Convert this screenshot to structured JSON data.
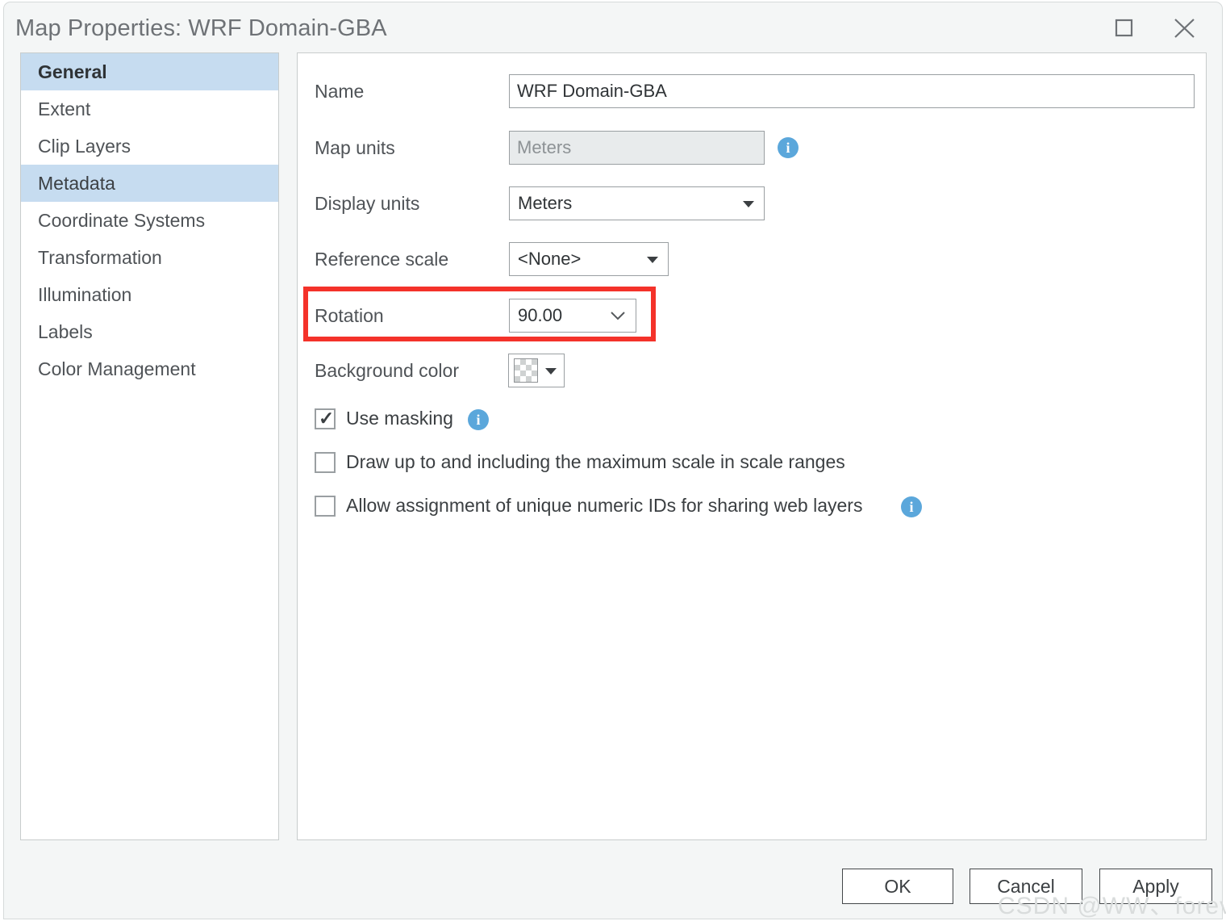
{
  "window": {
    "title": "Map Properties: WRF Domain-GBA",
    "maximize_icon": "maximize-icon",
    "close_icon": "close-icon"
  },
  "sidebar": {
    "items": [
      {
        "label": "General",
        "state": "selected"
      },
      {
        "label": "Extent",
        "state": "normal"
      },
      {
        "label": "Clip Layers",
        "state": "normal"
      },
      {
        "label": "Metadata",
        "state": "hover"
      },
      {
        "label": "Coordinate Systems",
        "state": "normal"
      },
      {
        "label": "Transformation",
        "state": "normal"
      },
      {
        "label": "Illumination",
        "state": "normal"
      },
      {
        "label": "Labels",
        "state": "normal"
      },
      {
        "label": "Color Management",
        "state": "normal"
      }
    ]
  },
  "general": {
    "name": {
      "label": "Name",
      "value": "WRF Domain-GBA"
    },
    "map_units": {
      "label": "Map units",
      "value": "Meters",
      "readonly": true,
      "info_icon": "info-icon"
    },
    "display_units": {
      "label": "Display units",
      "value": "Meters",
      "dropdown_icon": "chevron-down-icon"
    },
    "reference_scale": {
      "label": "Reference scale",
      "value": "<None>",
      "dropdown_icon": "chevron-down-icon"
    },
    "rotation": {
      "label": "Rotation",
      "value": "90.00",
      "dropdown_icon": "chevron-down-icon"
    },
    "background_color": {
      "label": "Background color",
      "value": "transparent",
      "dropdown_icon": "chevron-down-icon"
    },
    "checkboxes": [
      {
        "label": "Use masking",
        "checked": true,
        "has_info": true
      },
      {
        "label": "Draw up to and including the maximum scale in scale ranges",
        "checked": false,
        "has_info": false
      },
      {
        "label": "Allow assignment of unique numeric IDs for sharing web layers",
        "checked": false,
        "has_info": true
      }
    ]
  },
  "footer": {
    "ok_label": "OK",
    "cancel_label": "Cancel",
    "apply_label": "Apply"
  },
  "watermark": {
    "text": "CSDN @WW、forever"
  },
  "colors": {
    "selection_blue": "#c6dcf0",
    "info_blue": "#5ba7db",
    "annotation_red": "#f4322a",
    "dialog_background": "#f4f6f6"
  }
}
